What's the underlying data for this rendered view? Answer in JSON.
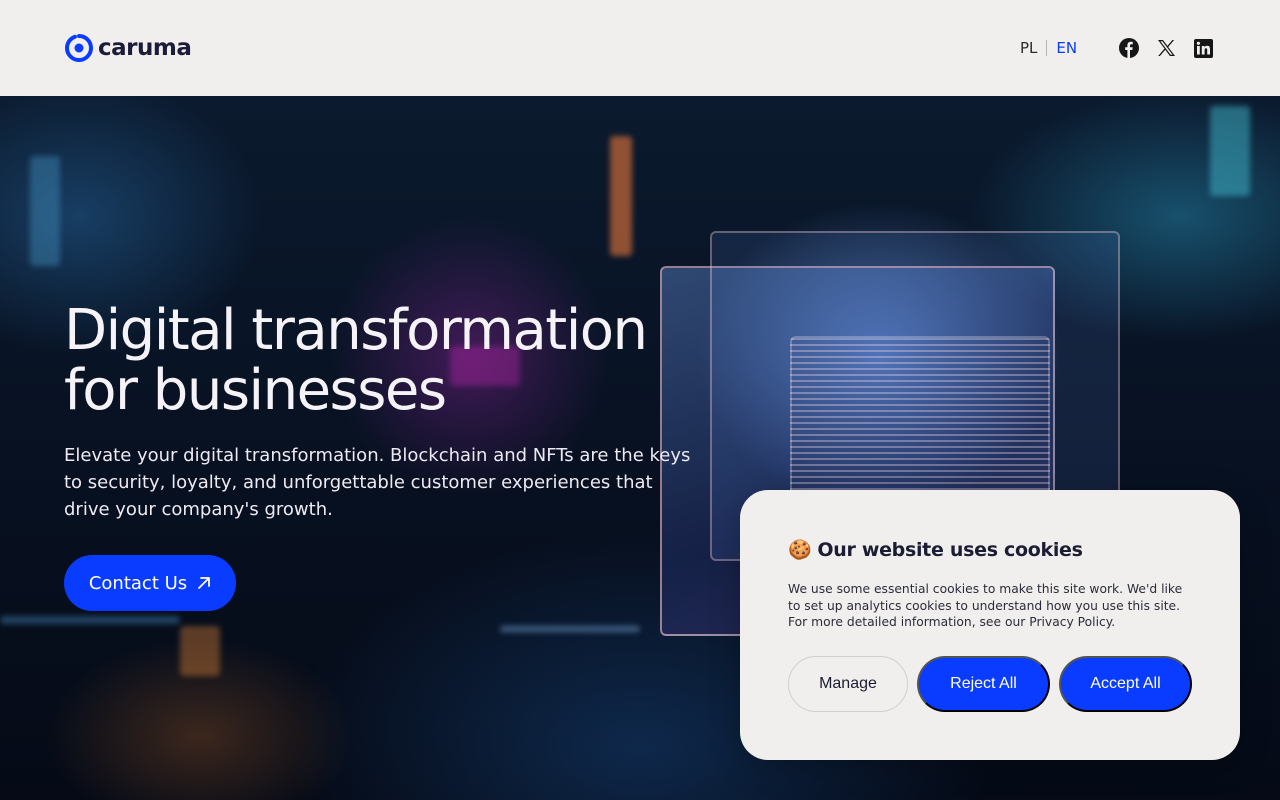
{
  "brand": {
    "name": "caruma",
    "accent": "#0a3cff"
  },
  "header": {
    "languages": [
      {
        "code": "PL",
        "active": false
      },
      {
        "code": "EN",
        "active": true
      }
    ],
    "social": [
      "facebook-icon",
      "x-twitter-icon",
      "linkedin-icon"
    ]
  },
  "hero": {
    "title_line1": "Digital transformation",
    "title_line2": "for businesses",
    "description": "Elevate your digital transformation. Blockchain and NFTs are the keys to security, loyalty, and unforgettable customer experiences that drive your company's growth.",
    "cta_label": "Contact Us"
  },
  "cookie": {
    "emoji": "🍪",
    "title": "Our website uses cookies",
    "text": "We use some essential cookies to make this site work. We'd like to set up analytics cookies to understand how you use this site. For more detailed information, see our Privacy Policy.",
    "manage_label": "Manage",
    "reject_label": "Reject All",
    "accept_label": "Accept All"
  }
}
